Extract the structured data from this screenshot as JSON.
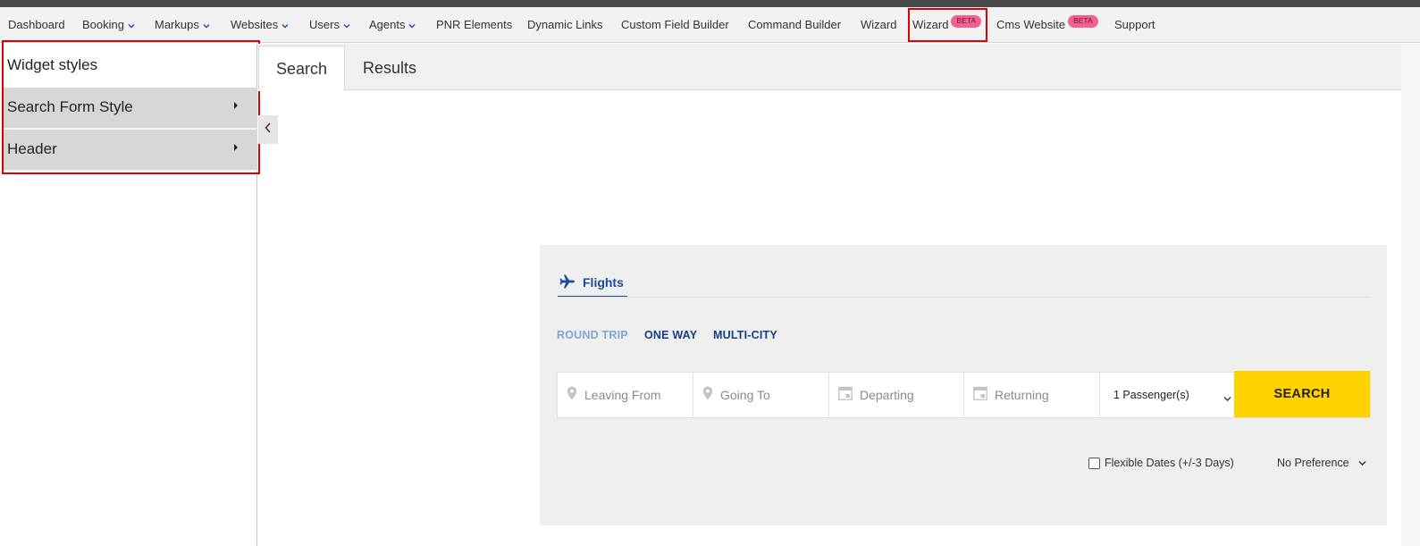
{
  "navbar": {
    "items": [
      {
        "label": "Dashboard",
        "dropdown": false
      },
      {
        "label": "Booking",
        "dropdown": true
      },
      {
        "label": "Markups",
        "dropdown": true
      },
      {
        "label": "Websites",
        "dropdown": true
      },
      {
        "label": "Users",
        "dropdown": true
      },
      {
        "label": "Agents",
        "dropdown": true
      },
      {
        "label": "PNR Elements",
        "dropdown": false
      },
      {
        "label": "Dynamic Links",
        "dropdown": false
      },
      {
        "label": "Custom Field Builder",
        "dropdown": false
      },
      {
        "label": "Command Builder",
        "dropdown": false
      },
      {
        "label": "Wizard",
        "dropdown": false
      },
      {
        "label": "Wizard",
        "badge": "BETA",
        "highlighted": true
      },
      {
        "label": "Cms Website",
        "badge": "BETA"
      },
      {
        "label": "Support",
        "dropdown": false
      }
    ]
  },
  "left_panel": {
    "title": "Widget styles",
    "items": [
      {
        "label": "Search Form Style"
      },
      {
        "label": "Header"
      }
    ]
  },
  "main_tabs": [
    {
      "label": "Search",
      "active": true
    },
    {
      "label": "Results",
      "active": false
    }
  ],
  "widget": {
    "product_tab": "Flights",
    "trip_types": [
      {
        "label": "ROUND TRIP",
        "active": true
      },
      {
        "label": "ONE WAY",
        "active": false
      },
      {
        "label": "MULTI-CITY",
        "active": false
      }
    ],
    "fields": {
      "leaving_from": "Leaving From",
      "going_to": "Going To",
      "departing": "Departing",
      "returning": "Returning"
    },
    "passengers": "1 Passenger(s)",
    "search_label": "SEARCH",
    "flexible_dates": "Flexible Dates (+/-3 Days)",
    "preference": "No Preference"
  },
  "colors": {
    "accent_blue": "#1a4d9c",
    "search_button": "#ffd200",
    "badge": "#f06292",
    "highlight_border": "#e00000"
  }
}
